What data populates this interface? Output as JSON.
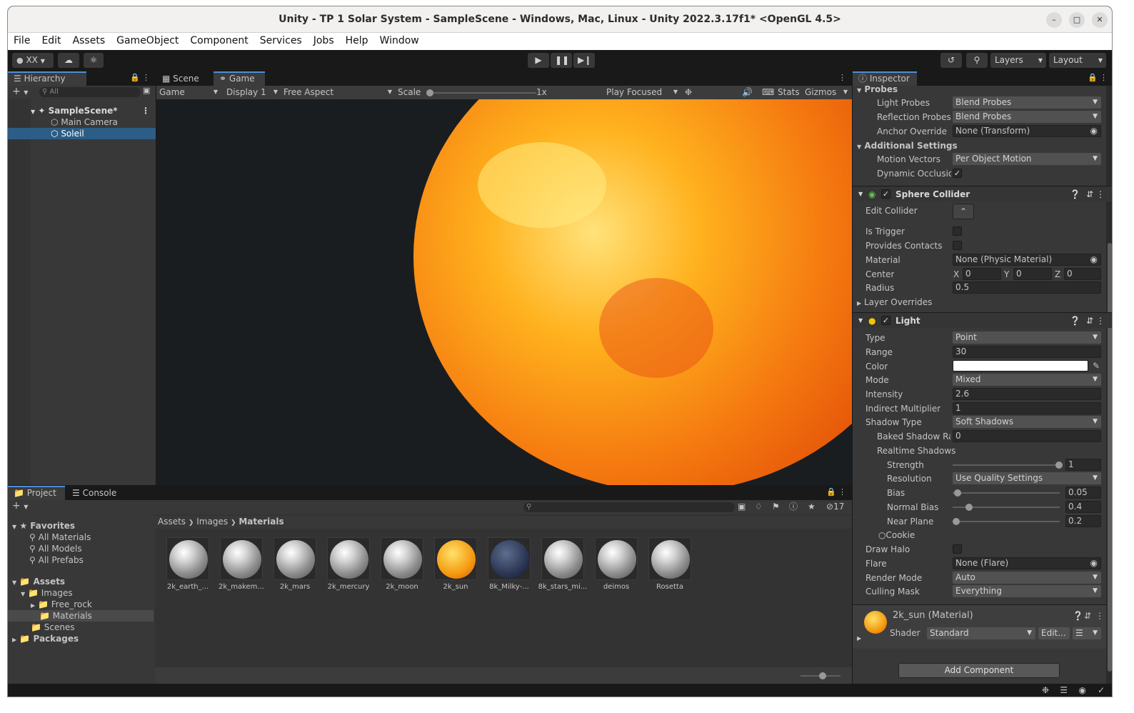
{
  "window": {
    "title": "Unity - TP 1 Solar System - SampleScene - Windows, Mac, Linux - Unity 2022.3.17f1* <OpenGL 4.5>"
  },
  "menu": [
    "File",
    "Edit",
    "Assets",
    "GameObject",
    "Component",
    "Services",
    "Jobs",
    "Help",
    "Window"
  ],
  "toolbar": {
    "account": "XX",
    "layers": "Layers",
    "layout": "Layout"
  },
  "hierarchy": {
    "tab": "Hierarchy",
    "search_placeholder": "All",
    "scene": "SampleScene*",
    "items": [
      "Main Camera",
      "Soleil"
    ]
  },
  "viewport": {
    "tabs": [
      "Scene",
      "Game"
    ],
    "game_label": "Game",
    "display": "Display 1",
    "aspect": "Free Aspect",
    "scale_label": "Scale",
    "scale_value": "1x",
    "play_mode": "Play Focused",
    "stats": "Stats",
    "gizmos": "Gizmos",
    "sun_color": "#ff9a00"
  },
  "inspector": {
    "tab": "Inspector",
    "probes": {
      "header": "Probes",
      "light_probes_label": "Light Probes",
      "light_probes": "Blend Probes",
      "reflection_probes_label": "Reflection Probes",
      "reflection_probes": "Blend Probes",
      "anchor_override_label": "Anchor Override",
      "anchor_override": "None (Transform)"
    },
    "additional": {
      "header": "Additional Settings",
      "motion_vectors_label": "Motion Vectors",
      "motion_vectors": "Per Object Motion",
      "dynamic_occlusion_label": "Dynamic Occlusion"
    },
    "sphere_collider": {
      "header": "Sphere Collider",
      "edit_collider_label": "Edit Collider",
      "is_trigger_label": "Is Trigger",
      "provides_contacts_label": "Provides Contacts",
      "material_label": "Material",
      "material": "None (Physic Material)",
      "center_label": "Center",
      "center_x": "0",
      "center_y": "0",
      "center_z": "0",
      "radius_label": "Radius",
      "radius": "0.5",
      "layer_overrides": "Layer Overrides"
    },
    "light": {
      "header": "Light",
      "type_label": "Type",
      "type": "Point",
      "range_label": "Range",
      "range": "30",
      "color_label": "Color",
      "color": "#ffffff",
      "mode_label": "Mode",
      "mode": "Mixed",
      "intensity_label": "Intensity",
      "intensity": "2.6",
      "indirect_label": "Indirect Multiplier",
      "indirect": "1",
      "shadow_type_label": "Shadow Type",
      "shadow_type": "Soft Shadows",
      "baked_radius_label": "Baked Shadow Radius",
      "baked_radius": "0",
      "realtime_label": "Realtime Shadows",
      "strength_label": "Strength",
      "strength": "1",
      "resolution_label": "Resolution",
      "resolution": "Use Quality Settings",
      "bias_label": "Bias",
      "bias": "0.05",
      "normal_bias_label": "Normal Bias",
      "normal_bias": "0.4",
      "near_plane_label": "Near Plane",
      "near_plane": "0.2",
      "cookie_label": "Cookie",
      "draw_halo_label": "Draw Halo",
      "flare_label": "Flare",
      "flare": "None (Flare)",
      "render_mode_label": "Render Mode",
      "render_mode": "Auto",
      "culling_mask_label": "Culling Mask",
      "culling_mask": "Everything"
    },
    "material": {
      "name": "2k_sun (Material)",
      "shader_label": "Shader",
      "shader": "Standard",
      "edit": "Edit..."
    },
    "add_component": "Add Component"
  },
  "project": {
    "tabs": [
      "Project",
      "Console"
    ],
    "hidden_count": "17",
    "favorites": "Favorites",
    "fav_items": [
      "All Materials",
      "All Models",
      "All Prefabs"
    ],
    "assets": "Assets",
    "images": "Images",
    "free_rock": "Free_rock",
    "materials": "Materials",
    "scenes": "Scenes",
    "packages": "Packages",
    "breadcrumb": [
      "Assets",
      "Images",
      "Materials"
    ],
    "files": [
      "2k_earth_...",
      "2k_makem...",
      "2k_mars",
      "2k_mercury",
      "2k_moon",
      "2k_sun",
      "8k_Milky-...",
      "8k_stars_mi...",
      "deimos",
      "Rosetta"
    ]
  }
}
